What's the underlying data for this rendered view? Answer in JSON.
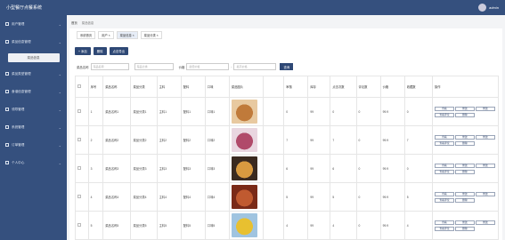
{
  "topbar": {
    "title": "小型餐厅点餐系统",
    "user": "admin"
  },
  "sidebar": {
    "items": [
      {
        "label": "用户管理",
        "icon": "list-icon"
      },
      {
        "label": "菜品信息管理",
        "icon": "list-icon"
      },
      {
        "label": "菜品类型管理",
        "icon": "list-icon"
      },
      {
        "label": "食谱信息管理",
        "icon": "list-icon"
      },
      {
        "label": "领导管理",
        "icon": "list-icon"
      },
      {
        "label": "系统管理",
        "icon": "list-icon"
      },
      {
        "label": "订单管理",
        "icon": "list-icon"
      },
      {
        "label": "个人中心",
        "icon": "list-icon"
      }
    ],
    "submenu_active": "菜品信息"
  },
  "breadcrumb": {
    "home": "首页",
    "current": "菜品信息"
  },
  "tabs": [
    {
      "label": "系统首页"
    },
    {
      "label": "用户 ×"
    },
    {
      "label": "菜品信息 ×"
    },
    {
      "label": "菜品分类 ×"
    }
  ],
  "buttons": {
    "add": "+ 添加",
    "delete": "删除",
    "export": "点击导出"
  },
  "search": {
    "name_label": "菜品名称",
    "name_placeholder": "菜品名称",
    "type_placeholder": "菜品分类",
    "price_label": "价格",
    "price_min_placeholder": "最低价格",
    "sep": "-",
    "price_max_placeholder": "最高价格",
    "button": "查询"
  },
  "table": {
    "headers": [
      "",
      "序号",
      "菜品名称",
      "菜品分类",
      "主料",
      "配料",
      "口味",
      "菜品图片",
      "",
      "审核",
      "库存",
      "点击次数",
      "评论数",
      "价格",
      "收藏数",
      "操作"
    ],
    "rows": [
      {
        "index": "1",
        "name": "菜品名称1",
        "category": "菜品分类1",
        "main": "主料1",
        "side": "配料1",
        "taste": "口味1",
        "c9": "0",
        "c10": "99",
        "c11": "0",
        "c12": "0",
        "price": "99.9",
        "fav": "0",
        "thumb": [
          "#e8c9a0",
          "#c07a3a"
        ]
      },
      {
        "index": "2",
        "name": "菜品名称2",
        "category": "菜品分类2",
        "main": "主料2",
        "side": "配料2",
        "taste": "口味2",
        "c9": "7",
        "c10": "99",
        "c11": "7",
        "c12": "0",
        "price": "99.9",
        "fav": "7",
        "thumb": [
          "#e9d6e0",
          "#b04a6a"
        ]
      },
      {
        "index": "3",
        "name": "菜品名称3",
        "category": "菜品分类3",
        "main": "主料3",
        "side": "配料3",
        "taste": "口味3",
        "c9": "6",
        "c10": "99",
        "c11": "6",
        "c12": "0",
        "price": "99.9",
        "fav": "0",
        "thumb": [
          "#3a2a20",
          "#d89a40"
        ]
      },
      {
        "index": "4",
        "name": "菜品名称4",
        "category": "菜品分类4",
        "main": "主料4",
        "side": "配料4",
        "taste": "口味4",
        "c9": "5",
        "c10": "99",
        "c11": "5",
        "c12": "0",
        "price": "99.9",
        "fav": "5",
        "thumb": [
          "#7a2a18",
          "#c05a30"
        ]
      },
      {
        "index": "5",
        "name": "菜品名称5",
        "category": "菜品分类5",
        "main": "主料5",
        "side": "配料5",
        "taste": "口味5",
        "c9": "4",
        "c10": "99",
        "c11": "4",
        "c12": "0",
        "price": "99.9",
        "fav": "4",
        "thumb": [
          "#a0c4e0",
          "#e8c030"
        ]
      }
    ],
    "ops": [
      "查看",
      "修改",
      "修改",
      "查看评论",
      "删除"
    ]
  },
  "colors": {
    "sidebar": "#35507e",
    "primary": "#2e4875"
  }
}
